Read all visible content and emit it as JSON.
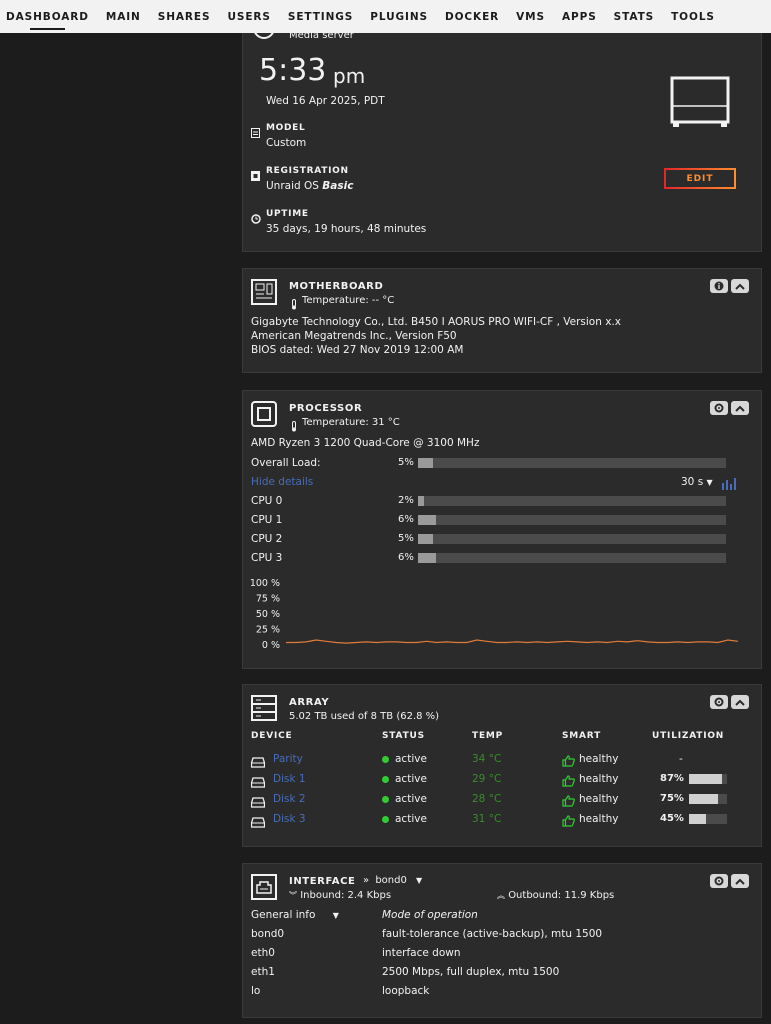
{
  "nav": {
    "items": [
      "DASHBOARD",
      "MAIN",
      "SHARES",
      "USERS",
      "SETTINGS",
      "PLUGINS",
      "DOCKER",
      "VMS",
      "APPS",
      "STATS",
      "TOOLS"
    ]
  },
  "server": {
    "description": "Media server",
    "time": "5:33",
    "ampm": "pm",
    "date": "Wed 16 Apr 2025, PDT",
    "model_label": "MODEL",
    "model_value": "Custom",
    "registration_label": "REGISTRATION",
    "registration_value": "Unraid OS",
    "registration_tier": "Basic",
    "uptime_label": "UPTIME",
    "uptime_value": "35 days, 19 hours, 48 minutes",
    "edit_label": "EDIT"
  },
  "motherboard": {
    "title": "MOTHERBOARD",
    "temperature": "Temperature: -- °C",
    "line1": "Gigabyte Technology Co., Ltd. B450 I AORUS PRO WIFI-CF , Version x.x",
    "line2": "American Megatrends Inc., Version F50",
    "line3": "BIOS dated: Wed 27 Nov 2019 12:00 AM"
  },
  "processor": {
    "title": "PROCESSOR",
    "temperature": "Temperature: 31 °C",
    "model": "AMD Ryzen 3 1200 Quad-Core @ 3100 MHz",
    "overall_label": "Overall Load:",
    "overall_value": "5%",
    "overall_pct": 5,
    "hide_details": "Hide details",
    "interval": "30 s",
    "cpus": [
      {
        "label": "CPU 0",
        "value": "2%",
        "pct": 2
      },
      {
        "label": "CPU 1",
        "value": "6%",
        "pct": 6
      },
      {
        "label": "CPU 2",
        "value": "5%",
        "pct": 5
      },
      {
        "label": "CPU 3",
        "value": "6%",
        "pct": 6
      }
    ],
    "graph_ticks": [
      "100 %",
      "75 %",
      "50 %",
      "25 %",
      "0 %"
    ],
    "line_color": "#e07b39"
  },
  "chart_data": {
    "type": "line",
    "ylim": [
      0,
      100
    ],
    "y_ticks": [
      "100 %",
      "75 %",
      "50 %",
      "25 %",
      "0 %"
    ],
    "series": [
      {
        "values": [
          4,
          4,
          5,
          8,
          6,
          4,
          3,
          4,
          5,
          4,
          5,
          5,
          4,
          4,
          6,
          4,
          5,
          4,
          4,
          8,
          6,
          4,
          4,
          5,
          4,
          5,
          4,
          5,
          6,
          5,
          4,
          5,
          4,
          6,
          5,
          7,
          5,
          4,
          4,
          5,
          4,
          5,
          5,
          4,
          8,
          6
        ]
      }
    ]
  },
  "array": {
    "title": "ARRAY",
    "usage": "5.02 TB used of 8 TB (62.8 %)",
    "headers": [
      "DEVICE",
      "STATUS",
      "TEMP",
      "SMART",
      "UTILIZATION"
    ],
    "rows": [
      {
        "device": "Parity",
        "status": "active",
        "temp": "34 °C",
        "smart": "healthy",
        "util": "-",
        "pct": null
      },
      {
        "device": "Disk 1",
        "status": "active",
        "temp": "29 °C",
        "smart": "healthy",
        "util": "87%",
        "pct": 87
      },
      {
        "device": "Disk 2",
        "status": "active",
        "temp": "28 °C",
        "smart": "healthy",
        "util": "75%",
        "pct": 75
      },
      {
        "device": "Disk 3",
        "status": "active",
        "temp": "31 °C",
        "smart": "healthy",
        "util": "45%",
        "pct": 45
      }
    ]
  },
  "interface": {
    "title": "INTERFACE",
    "selected": "bond0",
    "inbound": "Inbound: 2.4 Kbps",
    "outbound": "Outbound: 11.9 Kbps",
    "info_select": "General info",
    "mode_header": "Mode of operation",
    "rows": [
      {
        "name": "bond0",
        "value": "fault-tolerance (active-backup), mtu 1500"
      },
      {
        "name": "eth0",
        "value": "interface down"
      },
      {
        "name": "eth1",
        "value": "2500 Mbps, full duplex, mtu 1500"
      },
      {
        "name": "lo",
        "value": "loopback"
      }
    ]
  },
  "colors": {
    "accent_orange": "#ff8c2f",
    "link_blue": "#486dba",
    "active_green": "#33cc33",
    "temp_green": "#3c8a2f"
  }
}
